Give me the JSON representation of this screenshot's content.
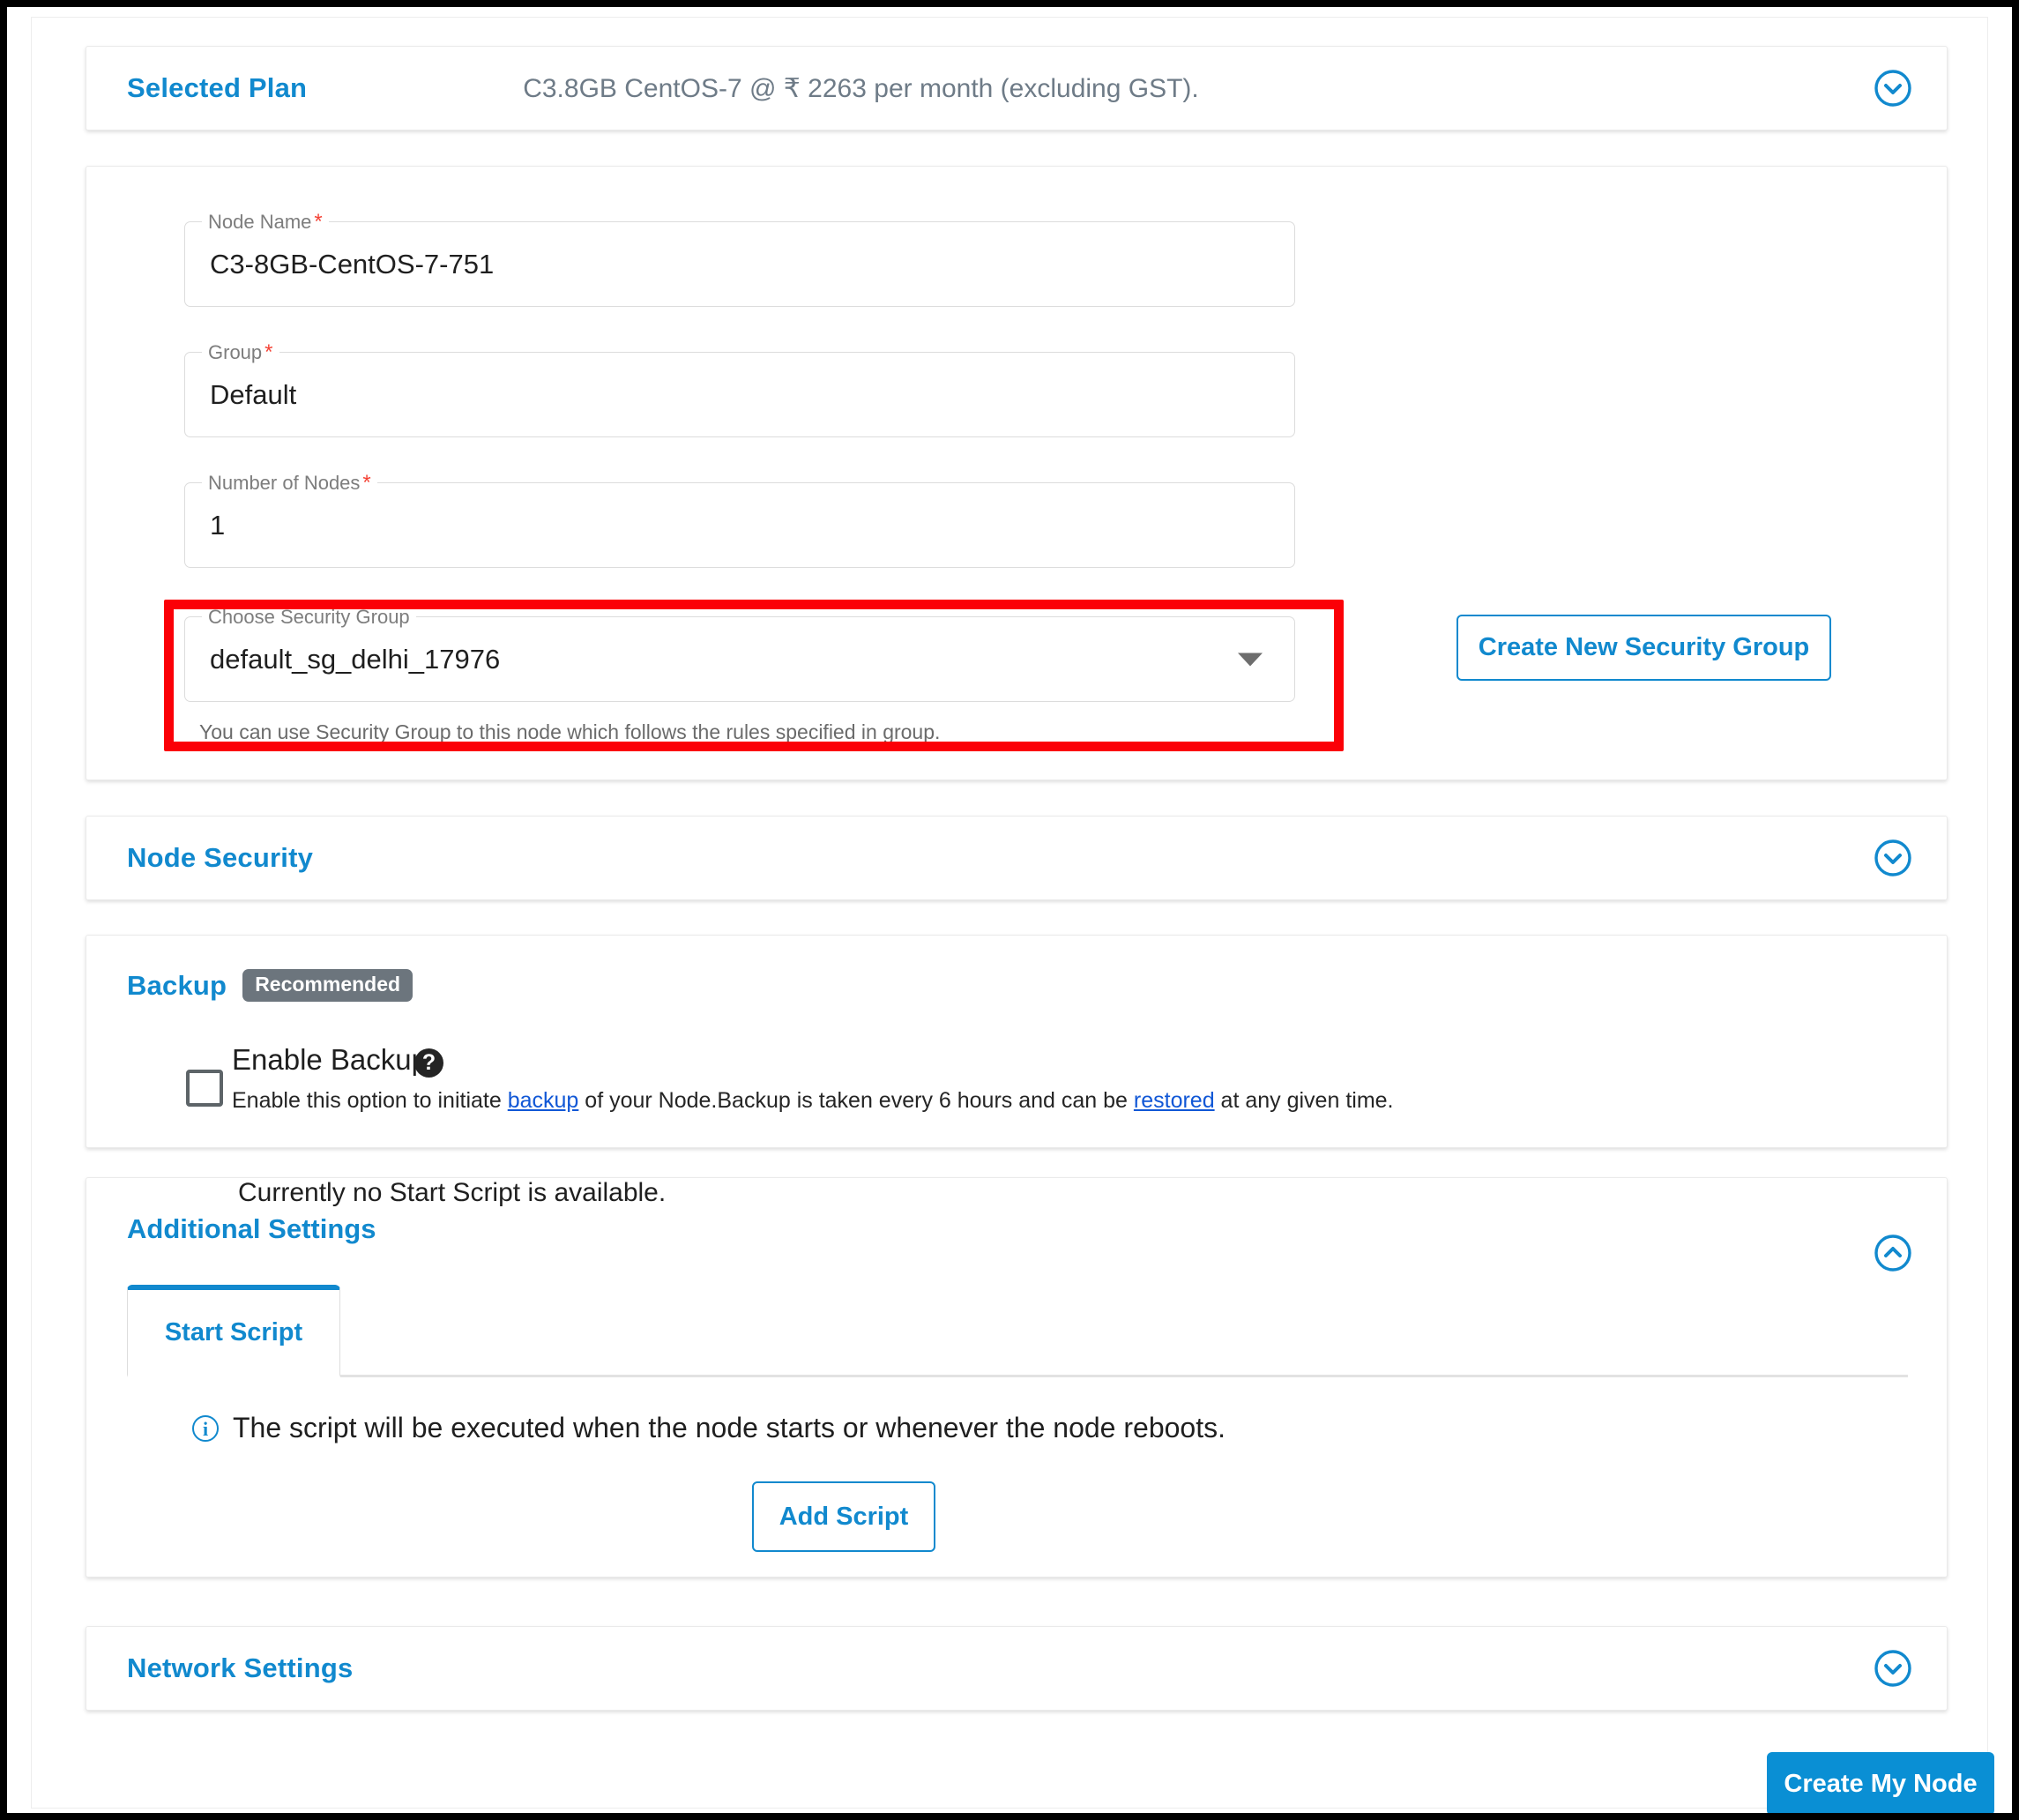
{
  "selected_plan": {
    "title": "Selected Plan",
    "summary": "C3.8GB CentOS-7 @  ₹  2263 per month (excluding GST).",
    "chevron": "chevron-down-icon"
  },
  "node_form": {
    "node_name": {
      "label": "Node Name",
      "required_mark": "*",
      "value": "C3-8GB-CentOS-7-751"
    },
    "group": {
      "label": "Group",
      "required_mark": "*",
      "value": "Default"
    },
    "number_of_nodes": {
      "label": "Number of Nodes",
      "required_mark": "*",
      "value": "1"
    },
    "security_group": {
      "label": "Choose Security Group",
      "value": "default_sg_delhi_17976",
      "hint": "You can use Security Group to this node which follows the rules specified in group.",
      "caret": "chevron-down-icon"
    },
    "create_new_sg_button": "Create New Security Group",
    "highlight_color": "#fb0007"
  },
  "node_security": {
    "title": "Node Security",
    "chevron": "chevron-down-icon"
  },
  "backup": {
    "title": "Backup",
    "badge": "Recommended",
    "enable_label": "Enable Backup",
    "help_glyph": "?",
    "description_part1": "Enable this option to initiate ",
    "link_backup": "backup",
    "description_part2": " of your Node.Backup is taken every 6 hours and can be ",
    "link_restored": "restored",
    "description_part3": " at any given time.",
    "checked": false
  },
  "additional_settings": {
    "title": "Additional Settings",
    "chevron": "chevron-up-icon",
    "tabs": [
      {
        "label": "Start Script",
        "active": true
      }
    ],
    "info_glyph": "i",
    "info_text": "The script will be executed when the node starts or whenever the node reboots.",
    "empty_text": "Currently no Start Script is available.",
    "add_script_button": "Add Script"
  },
  "network_settings": {
    "title": "Network Settings",
    "chevron": "chevron-down-icon"
  },
  "footer": {
    "create_node_button": "Create My Node"
  },
  "colors": {
    "accent_blue": "#1189ce",
    "primary_button": "#0a8fd4",
    "badge_gray": "#6c757d",
    "required_red": "#f44336",
    "highlight_red": "#fb0007",
    "link_blue": "#1057d6"
  }
}
